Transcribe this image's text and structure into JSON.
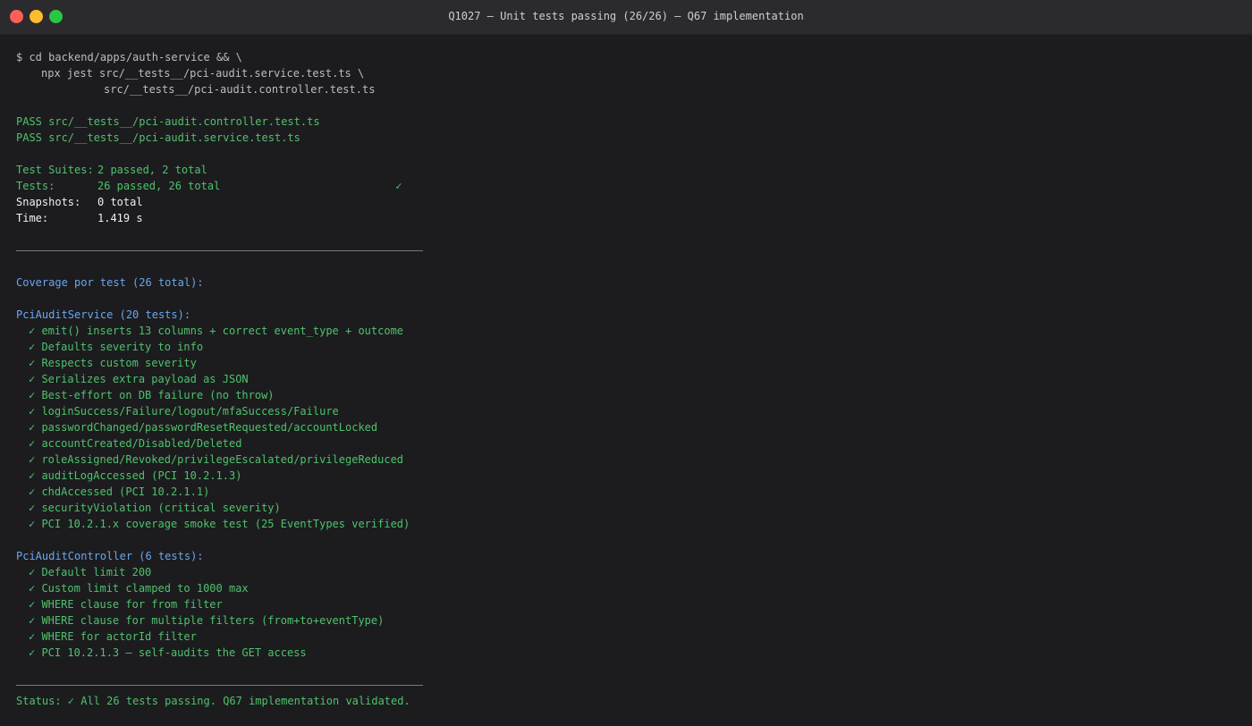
{
  "window": {
    "title": "Q1027 — Unit tests passing (26/26) — Q67 implementation"
  },
  "command": {
    "line1": "$ cd backend/apps/auth-service && \\",
    "line2": "npx jest src/__tests__/pci-audit.service.test.ts \\",
    "line3": "src/__tests__/pci-audit.controller.test.ts"
  },
  "results": {
    "pass1": "PASS src/__tests__/pci-audit.controller.test.ts",
    "pass2": "PASS src/__tests__/pci-audit.service.test.ts"
  },
  "summary": {
    "suites_label": "Test Suites:",
    "suites_value": "2 passed, 2 total",
    "tests_label": "Tests:",
    "tests_value": "26 passed, 26 total",
    "tests_check": "✓",
    "snapshots_label": "Snapshots:",
    "snapshots_value": "0 total",
    "time_label": "Time:",
    "time_value": "1.419 s"
  },
  "coverage": {
    "heading": "Coverage por test (26 total):",
    "service": {
      "heading": "PciAuditService (20 tests):",
      "items": [
        "✓ emit() inserts 13 columns + correct event_type + outcome",
        "✓ Defaults severity to info",
        "✓ Respects custom severity",
        "✓ Serializes extra payload as JSON",
        "✓ Best-effort on DB failure (no throw)",
        "✓ loginSuccess/Failure/logout/mfaSuccess/Failure",
        "✓ passwordChanged/passwordResetRequested/accountLocked",
        "✓ accountCreated/Disabled/Deleted",
        "✓ roleAssigned/Revoked/privilegeEscalated/privilegeReduced",
        "✓ auditLogAccessed (PCI 10.2.1.3)",
        "✓ chdAccessed (PCI 10.2.1.1)",
        "✓ securityViolation (critical severity)",
        "✓ PCI 10.2.1.x coverage smoke test (25 EventTypes verified)"
      ]
    },
    "controller": {
      "heading": "PciAuditController (6 tests):",
      "items": [
        "✓ Default limit 200",
        "✓ Custom limit clamped to 1000 max",
        "✓ WHERE clause for from filter",
        "✓ WHERE clause for multiple filters (from+to+eventType)",
        "✓ WHERE for actorId filter",
        "✓ PCI 10.2.1.3 — self-audits the GET access"
      ]
    }
  },
  "status": "Status: ✓ All 26 tests passing. Q67 implementation validated.",
  "colors": {
    "background": "#1c1c1f",
    "titlebar": "#2b2b2e",
    "green": "#4fc26a",
    "blue": "#6aa6f0",
    "gray": "#bdbdbf",
    "white": "#f0f0f0"
  }
}
